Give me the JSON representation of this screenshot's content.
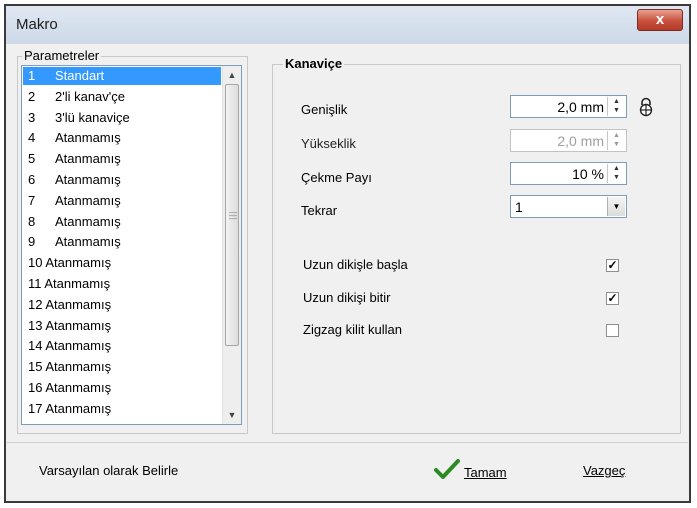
{
  "window": {
    "title": "Makro",
    "close_glyph": "x"
  },
  "parameters": {
    "legend": "Parametreler",
    "items": [
      {
        "num": "1",
        "label": "Standart",
        "selected": true
      },
      {
        "num": "2",
        "label": "2'li kanav'çe"
      },
      {
        "num": "3",
        "label": "3'lü kanaviçe"
      },
      {
        "num": "4",
        "label": "Atanmamış"
      },
      {
        "num": "5",
        "label": "Atanmamış"
      },
      {
        "num": "6",
        "label": "Atanmamış"
      },
      {
        "num": "7",
        "label": "Atanmamış"
      },
      {
        "num": "8",
        "label": "Atanmamış"
      },
      {
        "num": "9",
        "label": "Atanmamış"
      },
      {
        "num": "",
        "label": "10 Atanmamış"
      },
      {
        "num": "",
        "label": "11 Atanmamış"
      },
      {
        "num": "",
        "label": "12 Atanmamış"
      },
      {
        "num": "",
        "label": "13 Atanmamış"
      },
      {
        "num": "",
        "label": "14 Atanmamış"
      },
      {
        "num": "",
        "label": "15 Atanmamış"
      },
      {
        "num": "",
        "label": "16 Atanmamış"
      },
      {
        "num": "",
        "label": "17 Atanmamış"
      }
    ]
  },
  "kanavice": {
    "legend": "Kanaviçe",
    "genislik": {
      "label": "Genişlik",
      "value": "2,0 mm",
      "icon": "lock-icon"
    },
    "yukseklik": {
      "label": "Yükseklik",
      "value": "2,0 mm",
      "disabled": true
    },
    "cekme": {
      "label": "Çekme Payı",
      "value": "10 %"
    },
    "tekrar": {
      "label": "Tekrar",
      "value": "1"
    },
    "checks": [
      {
        "label": "Uzun dikişle başla",
        "checked": true,
        "mark": "✓"
      },
      {
        "label": "Uzun dikişi bitir",
        "checked": true,
        "mark": "✓"
      },
      {
        "label": "Zigzag kilit kullan",
        "checked": false,
        "mark": ""
      }
    ]
  },
  "footer": {
    "default_label": "Varsayılan olarak Belirle",
    "ok_label": "Tamam",
    "cancel_label": "Vazgeç",
    "ok_icon": "checkmark-icon",
    "accent_check": "#2c8a22"
  }
}
